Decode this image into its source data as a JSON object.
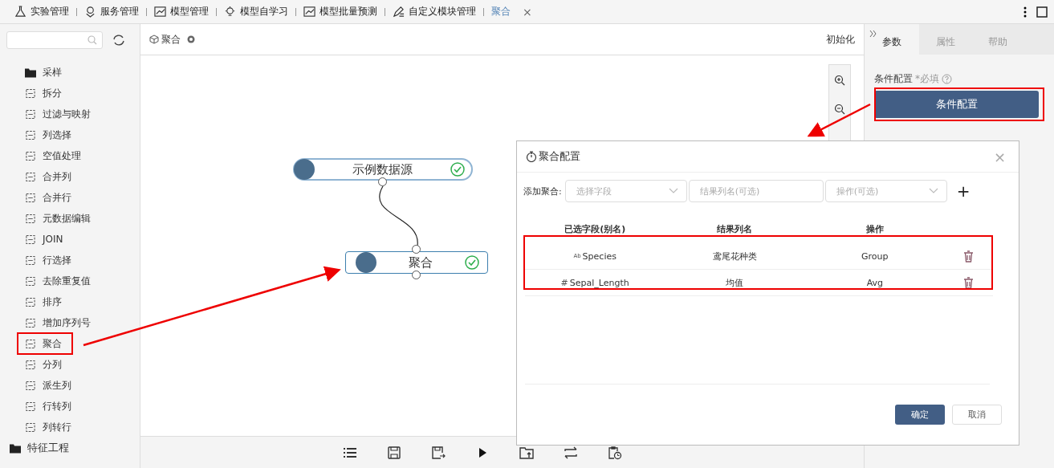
{
  "top_tabs": [
    {
      "label": "实验管理",
      "selected": false
    },
    {
      "label": "服务管理",
      "selected": false
    },
    {
      "label": "模型管理",
      "selected": false
    },
    {
      "label": "模型自学习",
      "selected": false
    },
    {
      "label": "模型批量预测",
      "selected": false
    },
    {
      "label": "自定义模块管理",
      "selected": false
    },
    {
      "label": "聚合",
      "selected": true
    }
  ],
  "close_glyph": "×",
  "sidebar": {
    "items": [
      {
        "label": "采样",
        "kind": "folder"
      },
      {
        "label": "拆分",
        "kind": "module"
      },
      {
        "label": "过滤与映射",
        "kind": "module"
      },
      {
        "label": "列选择",
        "kind": "module"
      },
      {
        "label": "空值处理",
        "kind": "module"
      },
      {
        "label": "合并列",
        "kind": "module"
      },
      {
        "label": "合并行",
        "kind": "module"
      },
      {
        "label": "元数据编辑",
        "kind": "module"
      },
      {
        "label": "JOIN",
        "kind": "module"
      },
      {
        "label": "行选择",
        "kind": "module"
      },
      {
        "label": "去除重复值",
        "kind": "module"
      },
      {
        "label": "排序",
        "kind": "module"
      },
      {
        "label": "增加序列号",
        "kind": "module"
      },
      {
        "label": "聚合",
        "kind": "module"
      },
      {
        "label": "分列",
        "kind": "module"
      },
      {
        "label": "派生列",
        "kind": "module"
      },
      {
        "label": "行转列",
        "kind": "module"
      },
      {
        "label": "列转行",
        "kind": "module"
      }
    ],
    "categories": [
      {
        "label": "特征工程"
      }
    ]
  },
  "canvas": {
    "title": "聚合",
    "init_button": "初始化",
    "nodes": [
      {
        "label": "示例数据源",
        "completed": true,
        "selected": false
      },
      {
        "label": "聚合",
        "completed": true,
        "selected": true
      }
    ]
  },
  "right_panel": {
    "tabs": [
      {
        "label": "参数",
        "selected": true
      },
      {
        "label": "属性",
        "selected": false
      },
      {
        "label": "帮助",
        "selected": false
      }
    ],
    "field_label": "条件配置",
    "required_mark": "*必填",
    "button": "条件配置"
  },
  "dialog": {
    "title": "聚合配置",
    "add_label": "添加聚合:",
    "field_select": {
      "placeholder": "选择字段"
    },
    "result_input": {
      "placeholder": "结果列名(可选)"
    },
    "op_select": {
      "placeholder": "操作(可选)"
    },
    "add_glyph": "+",
    "columns": [
      "已选字段(别名)",
      "结果列名",
      "操作"
    ],
    "rows": [
      {
        "type_mark": "Ab",
        "field": "Species",
        "result": "鸢尾花种类",
        "operation": "Group"
      },
      {
        "type_mark": "#",
        "field": "Sepal_Length",
        "result": "均值",
        "operation": "Avg"
      }
    ],
    "ok_button": "确定",
    "cancel_button": "取消",
    "close_glyph": "×"
  }
}
